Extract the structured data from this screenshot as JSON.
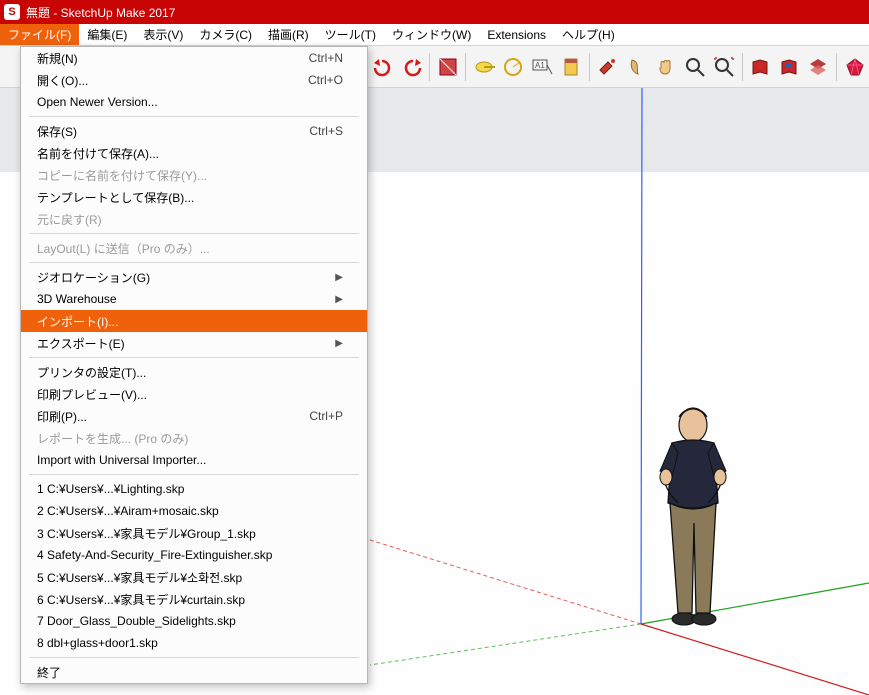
{
  "title": "無題 - SketchUp Make 2017",
  "app_icon_glyph": "S",
  "menubar": [
    "ファイル(F)",
    "編集(E)",
    "表示(V)",
    "カメラ(C)",
    "描画(R)",
    "ツール(T)",
    "ウィンドウ(W)",
    "Extensions",
    "ヘルプ(H)"
  ],
  "toolbar_icons": [
    "undo-icon",
    "redo-icon",
    "shadow-toggle-icon",
    "tape-icon",
    "protractor-icon",
    "text-icon",
    "structure-icon",
    "paint-icon",
    "outliner-icon",
    "hand-icon",
    "zoom-icon",
    "zoom-extents-icon",
    "book-red-icon",
    "book-blue-icon",
    "layers-icon",
    "ruby-icon"
  ],
  "dropdown": {
    "items": [
      {
        "label": "新規(N)",
        "shortcut": "Ctrl+N"
      },
      {
        "label": "開く(O)...",
        "shortcut": "Ctrl+O"
      },
      {
        "label": "Open Newer Version..."
      },
      {
        "sep": true
      },
      {
        "label": "保存(S)",
        "shortcut": "Ctrl+S"
      },
      {
        "label": "名前を付けて保存(A)..."
      },
      {
        "label": "コピーに名前を付けて保存(Y)...",
        "disabled": true
      },
      {
        "label": "テンプレートとして保存(B)..."
      },
      {
        "label": "元に戻す(R)",
        "disabled": true
      },
      {
        "sep": true
      },
      {
        "label": "LayOut(L) に送信（Pro のみ）...",
        "disabled": true
      },
      {
        "sep": true
      },
      {
        "label": "ジオロケーション(G)",
        "submenu": true
      },
      {
        "label": "3D Warehouse",
        "submenu": true
      },
      {
        "label": "インポート(I)...",
        "highlight": true
      },
      {
        "label": "エクスポート(E)",
        "submenu": true
      },
      {
        "sep": true
      },
      {
        "label": "プリンタの設定(T)..."
      },
      {
        "label": "印刷プレビュー(V)..."
      },
      {
        "label": "印刷(P)...",
        "shortcut": "Ctrl+P"
      },
      {
        "label": "レポートを生成... (Pro のみ)",
        "disabled": true
      },
      {
        "label": "Import with Universal Importer..."
      },
      {
        "sep": true
      },
      {
        "label": "1 C:¥Users¥...¥Lighting.skp"
      },
      {
        "label": "2 C:¥Users¥...¥Airam+mosaic.skp"
      },
      {
        "label": "3 C:¥Users¥...¥家具モデル¥Group_1.skp"
      },
      {
        "label": "4 Safety-And-Security_Fire-Extinguisher.skp"
      },
      {
        "label": "5 C:¥Users¥...¥家具モデル¥소화전.skp"
      },
      {
        "label": "6 C:¥Users¥...¥家具モデル¥curtain.skp"
      },
      {
        "label": "7 Door_Glass_Double_Sidelights.skp"
      },
      {
        "label": "8 dbl+glass+door1.skp"
      },
      {
        "sep": true
      },
      {
        "label": "終了"
      }
    ]
  }
}
